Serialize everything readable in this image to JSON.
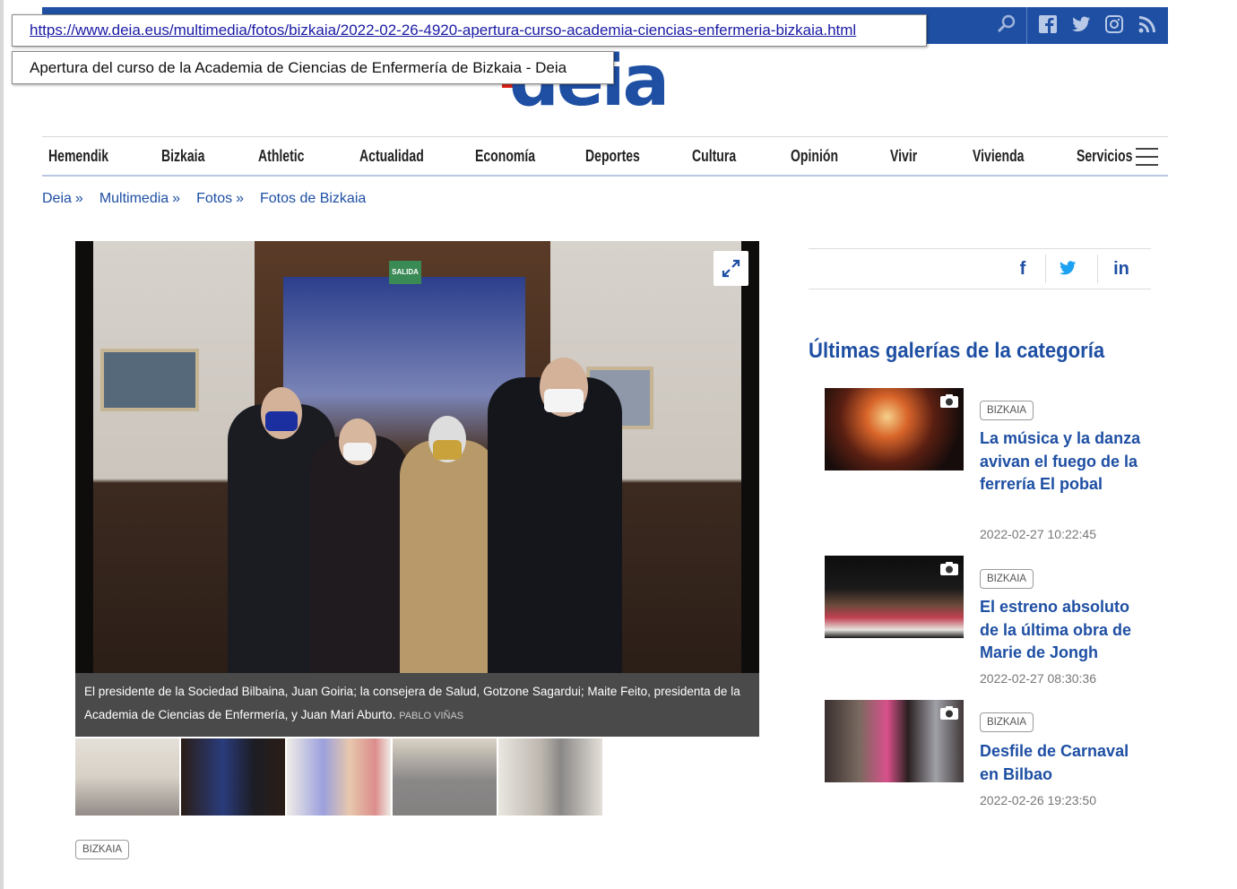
{
  "tooltip": {
    "url": "https://www.deia.eus/multimedia/fotos/bizkaia/2022-02-26-4920-apertura-curso-academia-ciencias-enfermeria-bizkaia.html",
    "title": "Apertura del curso de la Academia de Ciencias de Enfermería de Bizkaia - Deia"
  },
  "header": {
    "logo_text": "deia",
    "social": [
      "facebook-icon",
      "twitter-icon",
      "instagram-icon",
      "rss-icon"
    ],
    "brand_color": "#1e4fa3"
  },
  "nav": {
    "items": [
      "Hemendik",
      "Bizkaia",
      "Athletic",
      "Actualidad",
      "Economía",
      "Deportes",
      "Cultura",
      "Opinión",
      "Vivir",
      "Vivienda",
      "Servicios"
    ]
  },
  "breadcrumb": [
    "Deia",
    "Multimedia",
    "Fotos",
    "Fotos de Bizkaia"
  ],
  "photo": {
    "sign": "SALIDA",
    "caption": "El presidente de la Sociedad Bilbaina, Juan Goiria; la consejera de Salud, Gotzone Sagardui; Maite Feito, presidenta de la Academia de Ciencias de Enfermería, y Juan Mari Aburto.",
    "credit": "PABLO VIÑAS"
  },
  "category_tag": "BIZKAIA",
  "sidebar": {
    "title": "Últimas galerías de la categoría",
    "galleries": [
      {
        "tag": "BIZKAIA",
        "title": "La música y la danza avivan el fuego de la ferrería El pobal",
        "date": "2022-02-27 10:22:45"
      },
      {
        "tag": "BIZKAIA",
        "title": "El estreno absoluto de la última obra de Marie de Jongh",
        "date": "2022-02-27 08:30:36"
      },
      {
        "tag": "BIZKAIA",
        "title": "Desfile de Carnaval en Bilbao",
        "date": "2022-02-26 19:23:50"
      }
    ]
  }
}
